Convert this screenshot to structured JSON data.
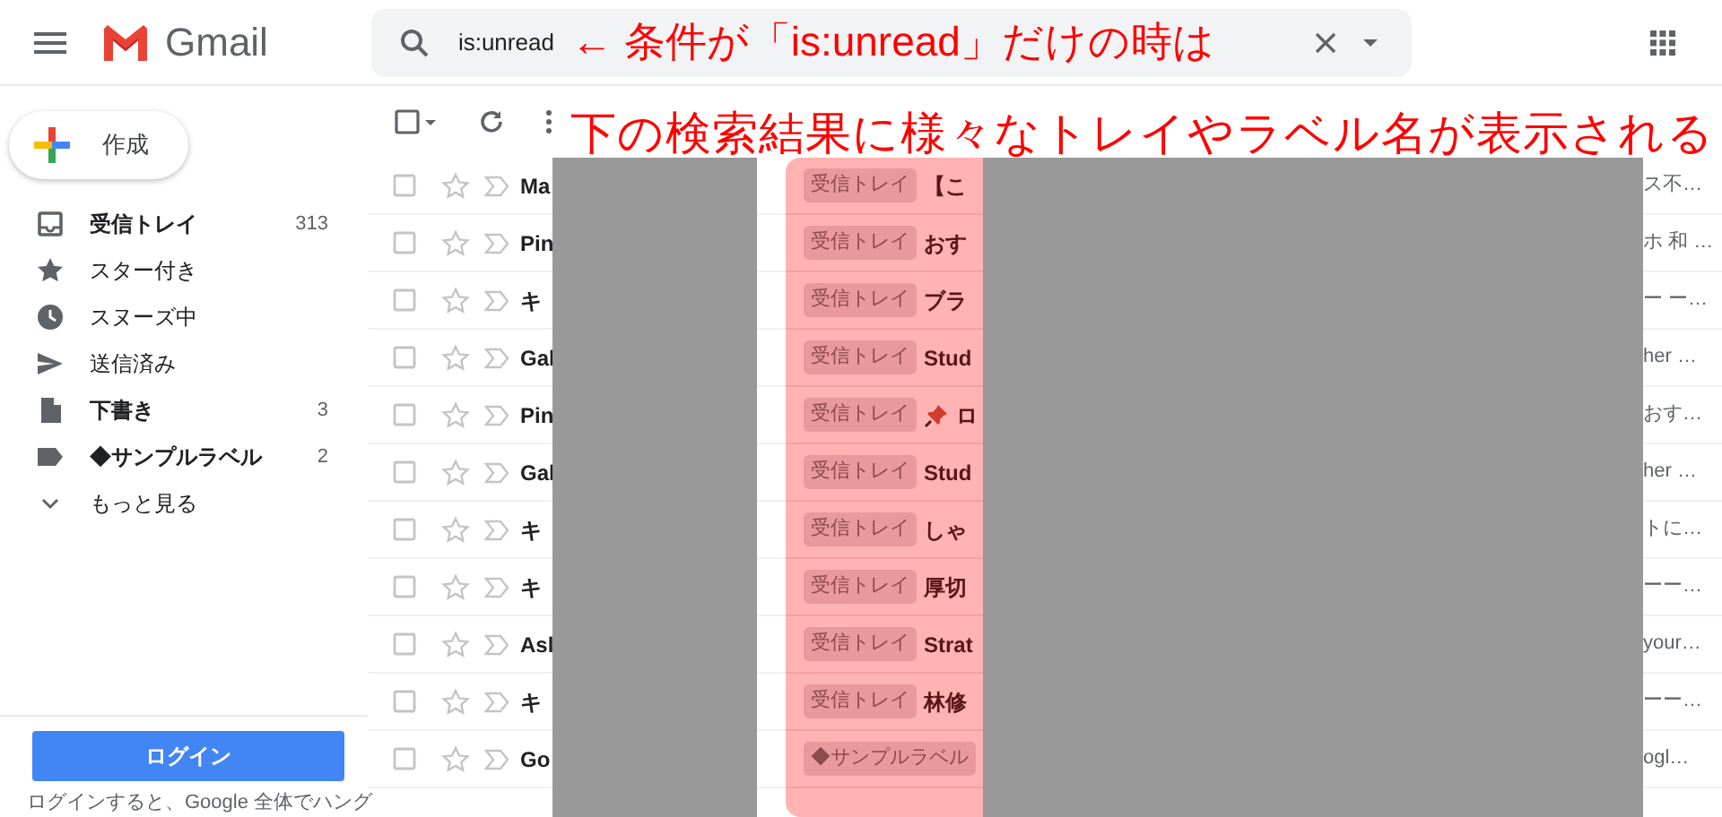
{
  "header": {
    "app_name": "Gmail"
  },
  "search": {
    "value": "is:unread",
    "annotation": "← 条件が「is:unread」だけの時は"
  },
  "toolbar": {
    "select_all_checked": false,
    "annotation": "下の検索結果に様々なトレイやラベル名が表示される"
  },
  "compose": {
    "label": "作成"
  },
  "sidebar": {
    "items": [
      {
        "kind": "inbox",
        "label": "受信トレイ",
        "count": "313",
        "unread": true,
        "selected": false
      },
      {
        "kind": "star",
        "label": "スター付き",
        "unread": false,
        "selected": false
      },
      {
        "kind": "clock",
        "label": "スヌーズ中",
        "unread": false,
        "selected": false
      },
      {
        "kind": "send",
        "label": "送信済み",
        "unread": false,
        "selected": false
      },
      {
        "kind": "draft",
        "label": "下書き",
        "count": "3",
        "unread": true,
        "selected": false
      },
      {
        "kind": "label",
        "label": "◆サンプルラベル",
        "count": "2",
        "unread": true,
        "selected": false
      },
      {
        "kind": "more",
        "label": "もっと見る",
        "unread": false,
        "selected": false
      }
    ],
    "login_button": "ログイン",
    "login_note": "ログインすると、Google 全体でハング"
  },
  "messages": [
    {
      "checked": false,
      "sender": "Ma",
      "label": "受信トレイ",
      "subject": "【こ",
      "pinned": false,
      "snippet": "ス不…"
    },
    {
      "checked": false,
      "sender": "Pin",
      "label": "受信トレイ",
      "subject": "おす",
      "pinned": false,
      "snippet": "ホ 和 …"
    },
    {
      "checked": false,
      "sender": "キ",
      "label": "受信トレイ",
      "subject": "ブラ",
      "pinned": false,
      "snippet": "ー ー…"
    },
    {
      "checked": false,
      "sender": "Gal",
      "label": "受信トレイ",
      "subject": "Stud",
      "pinned": false,
      "snippet": "her …"
    },
    {
      "checked": false,
      "sender": "Pin",
      "label": "受信トレイ",
      "subject": "ロ",
      "pinned": true,
      "snippet": "おす…"
    },
    {
      "checked": false,
      "sender": "Gal",
      "label": "受信トレイ",
      "subject": "Stud",
      "pinned": false,
      "snippet": "her …"
    },
    {
      "checked": false,
      "sender": "キ",
      "label": "受信トレイ",
      "subject": "しゃ",
      "pinned": false,
      "snippet": "トに…"
    },
    {
      "checked": false,
      "sender": "キ",
      "label": "受信トレイ",
      "subject": "厚切",
      "pinned": false,
      "snippet": "ーー…"
    },
    {
      "checked": false,
      "sender": "Asl",
      "label": "受信トレイ",
      "subject": "Strat",
      "pinned": false,
      "snippet": "your…"
    },
    {
      "checked": false,
      "sender": "キ",
      "label": "受信トレイ",
      "subject": "林修",
      "pinned": false,
      "snippet": "ーー…"
    },
    {
      "checked": false,
      "sender": "Go",
      "label": "◆サンプルラベル",
      "pinned": false,
      "snippet": "ogl…"
    }
  ]
}
